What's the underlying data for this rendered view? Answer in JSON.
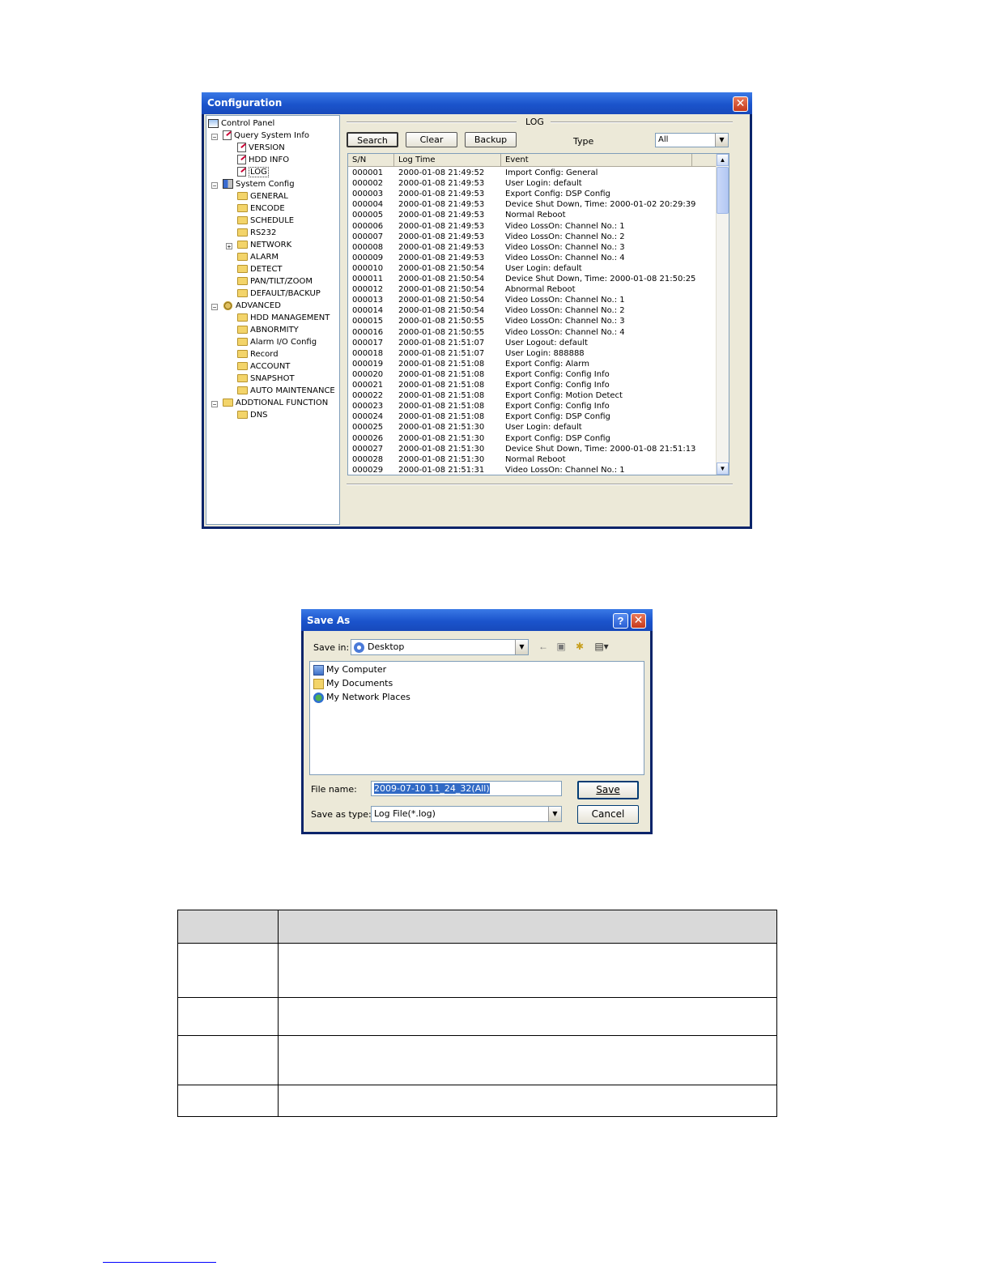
{
  "config_window": {
    "title": "Configuration",
    "close_glyph": "✕",
    "tree": {
      "control_panel": "Control Panel",
      "query_system_info": "Query System Info",
      "version": "VERSION",
      "hdd_info": "HDD INFO",
      "log": "LOG",
      "system_config": "System Config",
      "general": "GENERAL",
      "encode": "ENCODE",
      "schedule": "SCHEDULE",
      "rs232": "RS232",
      "network": "NETWORK",
      "alarm": "ALARM",
      "detect": "DETECT",
      "ptz": "PAN/TILT/ZOOM",
      "default_backup": "DEFAULT/BACKUP",
      "advanced": "ADVANCED",
      "hdd_management": "HDD MANAGEMENT",
      "abnormity": "ABNORMITY",
      "alarm_io": "Alarm I/O Config",
      "record": "Record",
      "account": "ACCOUNT",
      "snapshot": "SNAPSHOT",
      "auto_maintenance": "AUTO MAINTENANCE",
      "additional_function": "ADDTIONAL FUNCTION",
      "dns": "DNS"
    },
    "log": {
      "section_title": "LOG",
      "search_label": "Search",
      "clear_label": "Clear",
      "backup_label": "Backup",
      "type_label": "Type",
      "type_value": "All",
      "columns": [
        "S/N",
        "Log Time",
        "Event"
      ],
      "rows": [
        [
          "000001",
          "2000-01-08 21:49:52",
          "Import Config: General"
        ],
        [
          "000002",
          "2000-01-08 21:49:53",
          "User Login: default"
        ],
        [
          "000003",
          "2000-01-08 21:49:53",
          "Export Config: DSP Config"
        ],
        [
          "000004",
          "2000-01-08 21:49:53",
          "Device Shut Down, Time: 2000-01-02 20:29:39"
        ],
        [
          "000005",
          "2000-01-08 21:49:53",
          "Normal Reboot"
        ],
        [
          "000006",
          "2000-01-08 21:49:53",
          "Video LossOn: Channel No.: 1"
        ],
        [
          "000007",
          "2000-01-08 21:49:53",
          "Video LossOn: Channel No.: 2"
        ],
        [
          "000008",
          "2000-01-08 21:49:53",
          "Video LossOn: Channel No.: 3"
        ],
        [
          "000009",
          "2000-01-08 21:49:53",
          "Video LossOn: Channel No.: 4"
        ],
        [
          "000010",
          "2000-01-08 21:50:54",
          "User Login: default"
        ],
        [
          "000011",
          "2000-01-08 21:50:54",
          "Device Shut Down, Time: 2000-01-08 21:50:25"
        ],
        [
          "000012",
          "2000-01-08 21:50:54",
          "Abnormal Reboot"
        ],
        [
          "000013",
          "2000-01-08 21:50:54",
          "Video LossOn: Channel No.: 1"
        ],
        [
          "000014",
          "2000-01-08 21:50:54",
          "Video LossOn: Channel No.: 2"
        ],
        [
          "000015",
          "2000-01-08 21:50:55",
          "Video LossOn: Channel No.: 3"
        ],
        [
          "000016",
          "2000-01-08 21:50:55",
          "Video LossOn: Channel No.: 4"
        ],
        [
          "000017",
          "2000-01-08 21:51:07",
          "User Logout: default"
        ],
        [
          "000018",
          "2000-01-08 21:51:07",
          "User Login: 888888"
        ],
        [
          "000019",
          "2000-01-08 21:51:08",
          "Export Config: Alarm"
        ],
        [
          "000020",
          "2000-01-08 21:51:08",
          "Export Config: Config Info"
        ],
        [
          "000021",
          "2000-01-08 21:51:08",
          "Export Config: Config Info"
        ],
        [
          "000022",
          "2000-01-08 21:51:08",
          "Export Config: Motion Detect"
        ],
        [
          "000023",
          "2000-01-08 21:51:08",
          "Export Config: Config Info"
        ],
        [
          "000024",
          "2000-01-08 21:51:08",
          "Export Config: DSP Config"
        ],
        [
          "000025",
          "2000-01-08 21:51:30",
          "User Login: default"
        ],
        [
          "000026",
          "2000-01-08 21:51:30",
          "Export Config: DSP Config"
        ],
        [
          "000027",
          "2000-01-08 21:51:30",
          "Device Shut Down, Time: 2000-01-08 21:51:13"
        ],
        [
          "000028",
          "2000-01-08 21:51:30",
          "Normal Reboot"
        ],
        [
          "000029",
          "2000-01-08 21:51:31",
          "Video LossOn: Channel No.: 1"
        ]
      ]
    }
  },
  "save_as": {
    "title": "Save As",
    "help_glyph": "?",
    "close_glyph": "✕",
    "save_in_label": "Save in:",
    "save_in_value": "Desktop",
    "places": [
      "My Computer",
      "My Documents",
      "My Network Places"
    ],
    "file_name_label": "File name:",
    "file_name_value": "2009-07-10 11_24_32(All)",
    "save_as_type_label": "Save as type:",
    "save_as_type_value": "Log File(*.log)",
    "save_label": "Save",
    "cancel_label": "Cancel"
  }
}
